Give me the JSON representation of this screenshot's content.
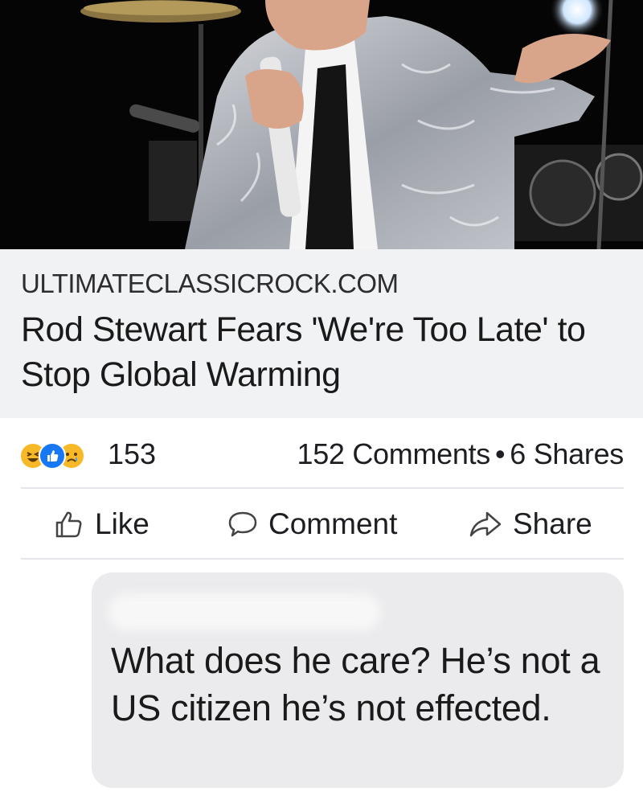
{
  "link_preview": {
    "image_icon": "concert-photo",
    "domain": "ULTIMATECLASSICROCK.COM",
    "headline": "Rod Stewart Fears 'We're Too Late' to Stop Global Warming"
  },
  "stats": {
    "reaction_icons": [
      "haha-reaction-icon",
      "like-reaction-icon",
      "sad-reaction-icon"
    ],
    "reaction_count": "153",
    "comments": "152 Comments",
    "separator": "•",
    "shares": "6 Shares"
  },
  "actions": {
    "like": {
      "label": "Like",
      "icon": "thumbs-up-icon"
    },
    "comment": {
      "label": "Comment",
      "icon": "speech-bubble-icon"
    },
    "share": {
      "label": "Share",
      "icon": "share-arrow-icon"
    }
  },
  "comment": {
    "text": "What does he care? He’s not a US citizen he’s not effected."
  },
  "colors": {
    "like_blue": "#1877f2",
    "emoji_yellow": "#f7b928",
    "card_bg": "#f1f2f4",
    "bubble_bg": "#ebebed"
  }
}
